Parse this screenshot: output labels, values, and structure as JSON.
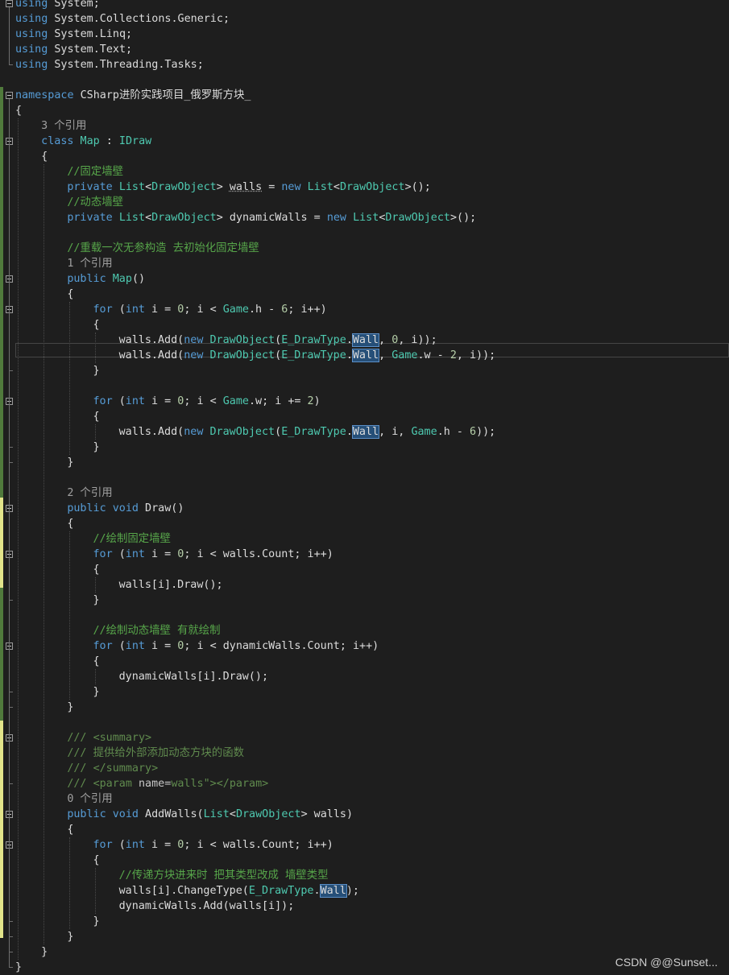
{
  "code": [
    "using System;",
    "using System.Collections.Generic;",
    "using System.Linq;",
    "using System.Text;",
    "using System.Threading.Tasks;",
    "",
    "namespace CSharp进阶实践项目_俄罗斯方块_",
    "{",
    "3 个引用",
    "class Map : IDraw",
    "{",
    "//固定墙壁",
    "private List<DrawObject> walls = new List<DrawObject>();",
    "//动态墙壁",
    "private List<DrawObject> dynamicWalls = new List<DrawObject>();",
    "",
    "//重载一次无参构造 去初始化固定墙壁",
    "1 个引用",
    "public Map()",
    "{",
    "for (int i = 0; i < Game.h - 6; i++)",
    "{",
    "walls.Add(new DrawObject(E_DrawType.Wall, 0, i));",
    "walls.Add(new DrawObject(E_DrawType.Wall, Game.w - 2, i));",
    "}",
    "",
    "for (int i = 0; i < Game.w; i += 2)",
    "{",
    "walls.Add(new DrawObject(E_DrawType.Wall, i, Game.h - 6));",
    "}",
    "}",
    "",
    "2 个引用",
    "public void Draw()",
    "{",
    "//绘制固定墙壁",
    "for (int i = 0; i < walls.Count; i++)",
    "{",
    "walls[i].Draw();",
    "}",
    "",
    "//绘制动态墙壁 有就绘制",
    "for (int i = 0; i < dynamicWalls.Count; i++)",
    "{",
    "dynamicWalls[i].Draw();",
    "}",
    "}",
    "",
    "/// <summary>",
    "/// 提供给外部添加动态方块的函数",
    "/// </summary>",
    "/// <param name=\"walls\"></param>",
    "0 个引用",
    "public void AddWalls(List<DrawObject> walls)",
    "{",
    "for (int i = 0; i < walls.Count; i++)",
    "{",
    "//传递方块进来时 把其类型改成 墙壁类型",
    "walls[i].ChangeType(E_DrawType.Wall);",
    "dynamicWalls.Add(walls[i]);",
    "}",
    "}",
    "}",
    "}"
  ],
  "watermark": "CSDN @@Sunset..."
}
